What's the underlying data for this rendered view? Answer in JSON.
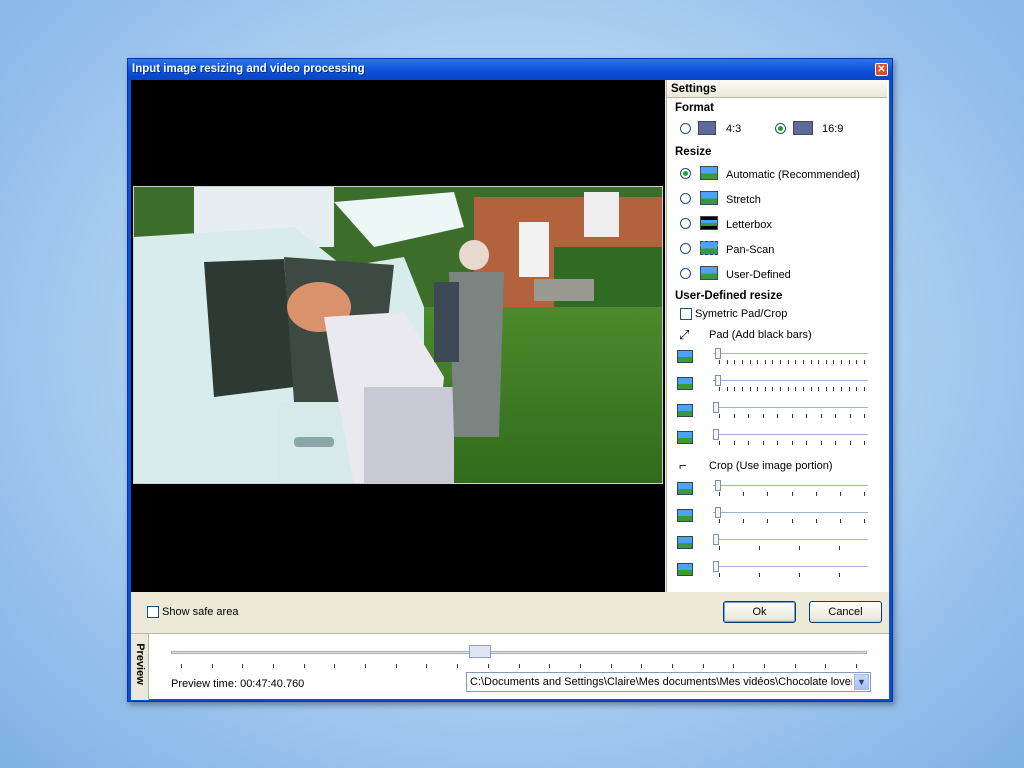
{
  "window": {
    "title": "Input image resizing and video processing",
    "close_label": "✕"
  },
  "settings": {
    "header": "Settings",
    "format": {
      "heading": "Format",
      "options": [
        {
          "label": "4:3",
          "selected": false
        },
        {
          "label": "16:9",
          "selected": true
        }
      ]
    },
    "resize": {
      "heading": "Resize",
      "options": [
        {
          "label": "Automatic (Recommended)",
          "selected": true
        },
        {
          "label": "Stretch",
          "selected": false
        },
        {
          "label": "Letterbox",
          "selected": false
        },
        {
          "label": "Pan-Scan",
          "selected": false
        },
        {
          "label": "User-Defined",
          "selected": false
        }
      ]
    },
    "user_defined": {
      "heading": "User-Defined resize",
      "symmetric_label": "Symetric Pad/Crop",
      "symmetric_checked": false,
      "pad_label": "Pad (Add black bars)",
      "crop_label": "Crop (Use image portion)"
    }
  },
  "bottom": {
    "show_safe_area_label": "Show safe area",
    "show_safe_area_checked": false,
    "ok_label": "Ok",
    "cancel_label": "Cancel"
  },
  "preview": {
    "tab_label": "Preview",
    "time_label": "Preview time: 00:47:40.760",
    "file_path": "C:\\Documents and Settings\\Claire\\Mes documents\\Mes vidéos\\Chocolate lovers"
  },
  "colors": {
    "title_bar": "#0a4fd8",
    "dialog_bg": "#ece9d8",
    "radio_selected": "#21a121"
  }
}
